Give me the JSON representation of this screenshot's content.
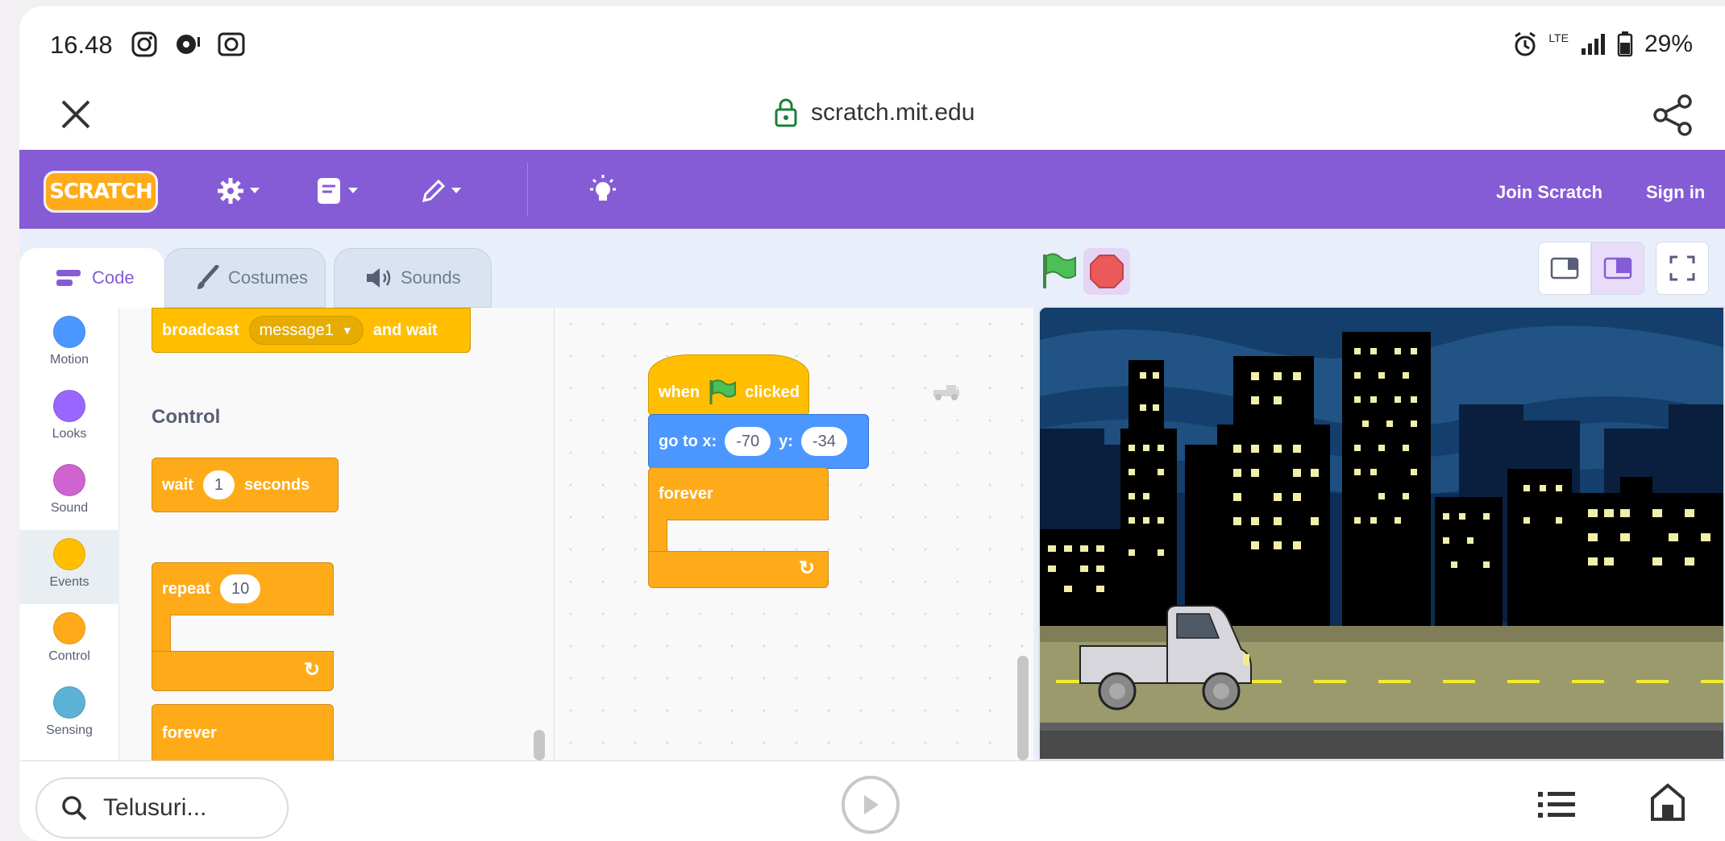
{
  "status": {
    "time": "16.48",
    "network": "LTE",
    "battery": "29%"
  },
  "browser": {
    "url": "scratch.mit.edu"
  },
  "menubar": {
    "logo_text": "SCRATCH",
    "join_label": "Join Scratch",
    "signin_label": "Sign in",
    "color": "#855cd6"
  },
  "tabs": [
    {
      "label": "Code"
    },
    {
      "label": "Costumes"
    },
    {
      "label": "Sounds"
    }
  ],
  "categories": [
    {
      "label": "Motion",
      "color": "#4c97ff"
    },
    {
      "label": "Looks",
      "color": "#9966ff"
    },
    {
      "label": "Sound",
      "color": "#cf63cf"
    },
    {
      "label": "Events",
      "color": "#ffbf00"
    },
    {
      "label": "Control",
      "color": "#ffab19"
    },
    {
      "label": "Sensing",
      "color": "#5cb1d6"
    }
  ],
  "palette": {
    "broadcast": {
      "label": "broadcast",
      "message": "message1",
      "suffix": "and wait"
    },
    "control_heading": "Control",
    "wait": {
      "label": "wait",
      "value": "1",
      "suffix": "seconds"
    },
    "repeat": {
      "label": "repeat",
      "value": "10"
    },
    "forever": {
      "label": "forever"
    }
  },
  "script": {
    "hat": {
      "prefix": "when",
      "suffix": "clicked"
    },
    "goto": {
      "label": "go to x:",
      "x": "-70",
      "ylabel": "y:",
      "y": "-34"
    },
    "forever": {
      "label": "forever"
    }
  },
  "bottom": {
    "search_placeholder": "Telusuri..."
  }
}
